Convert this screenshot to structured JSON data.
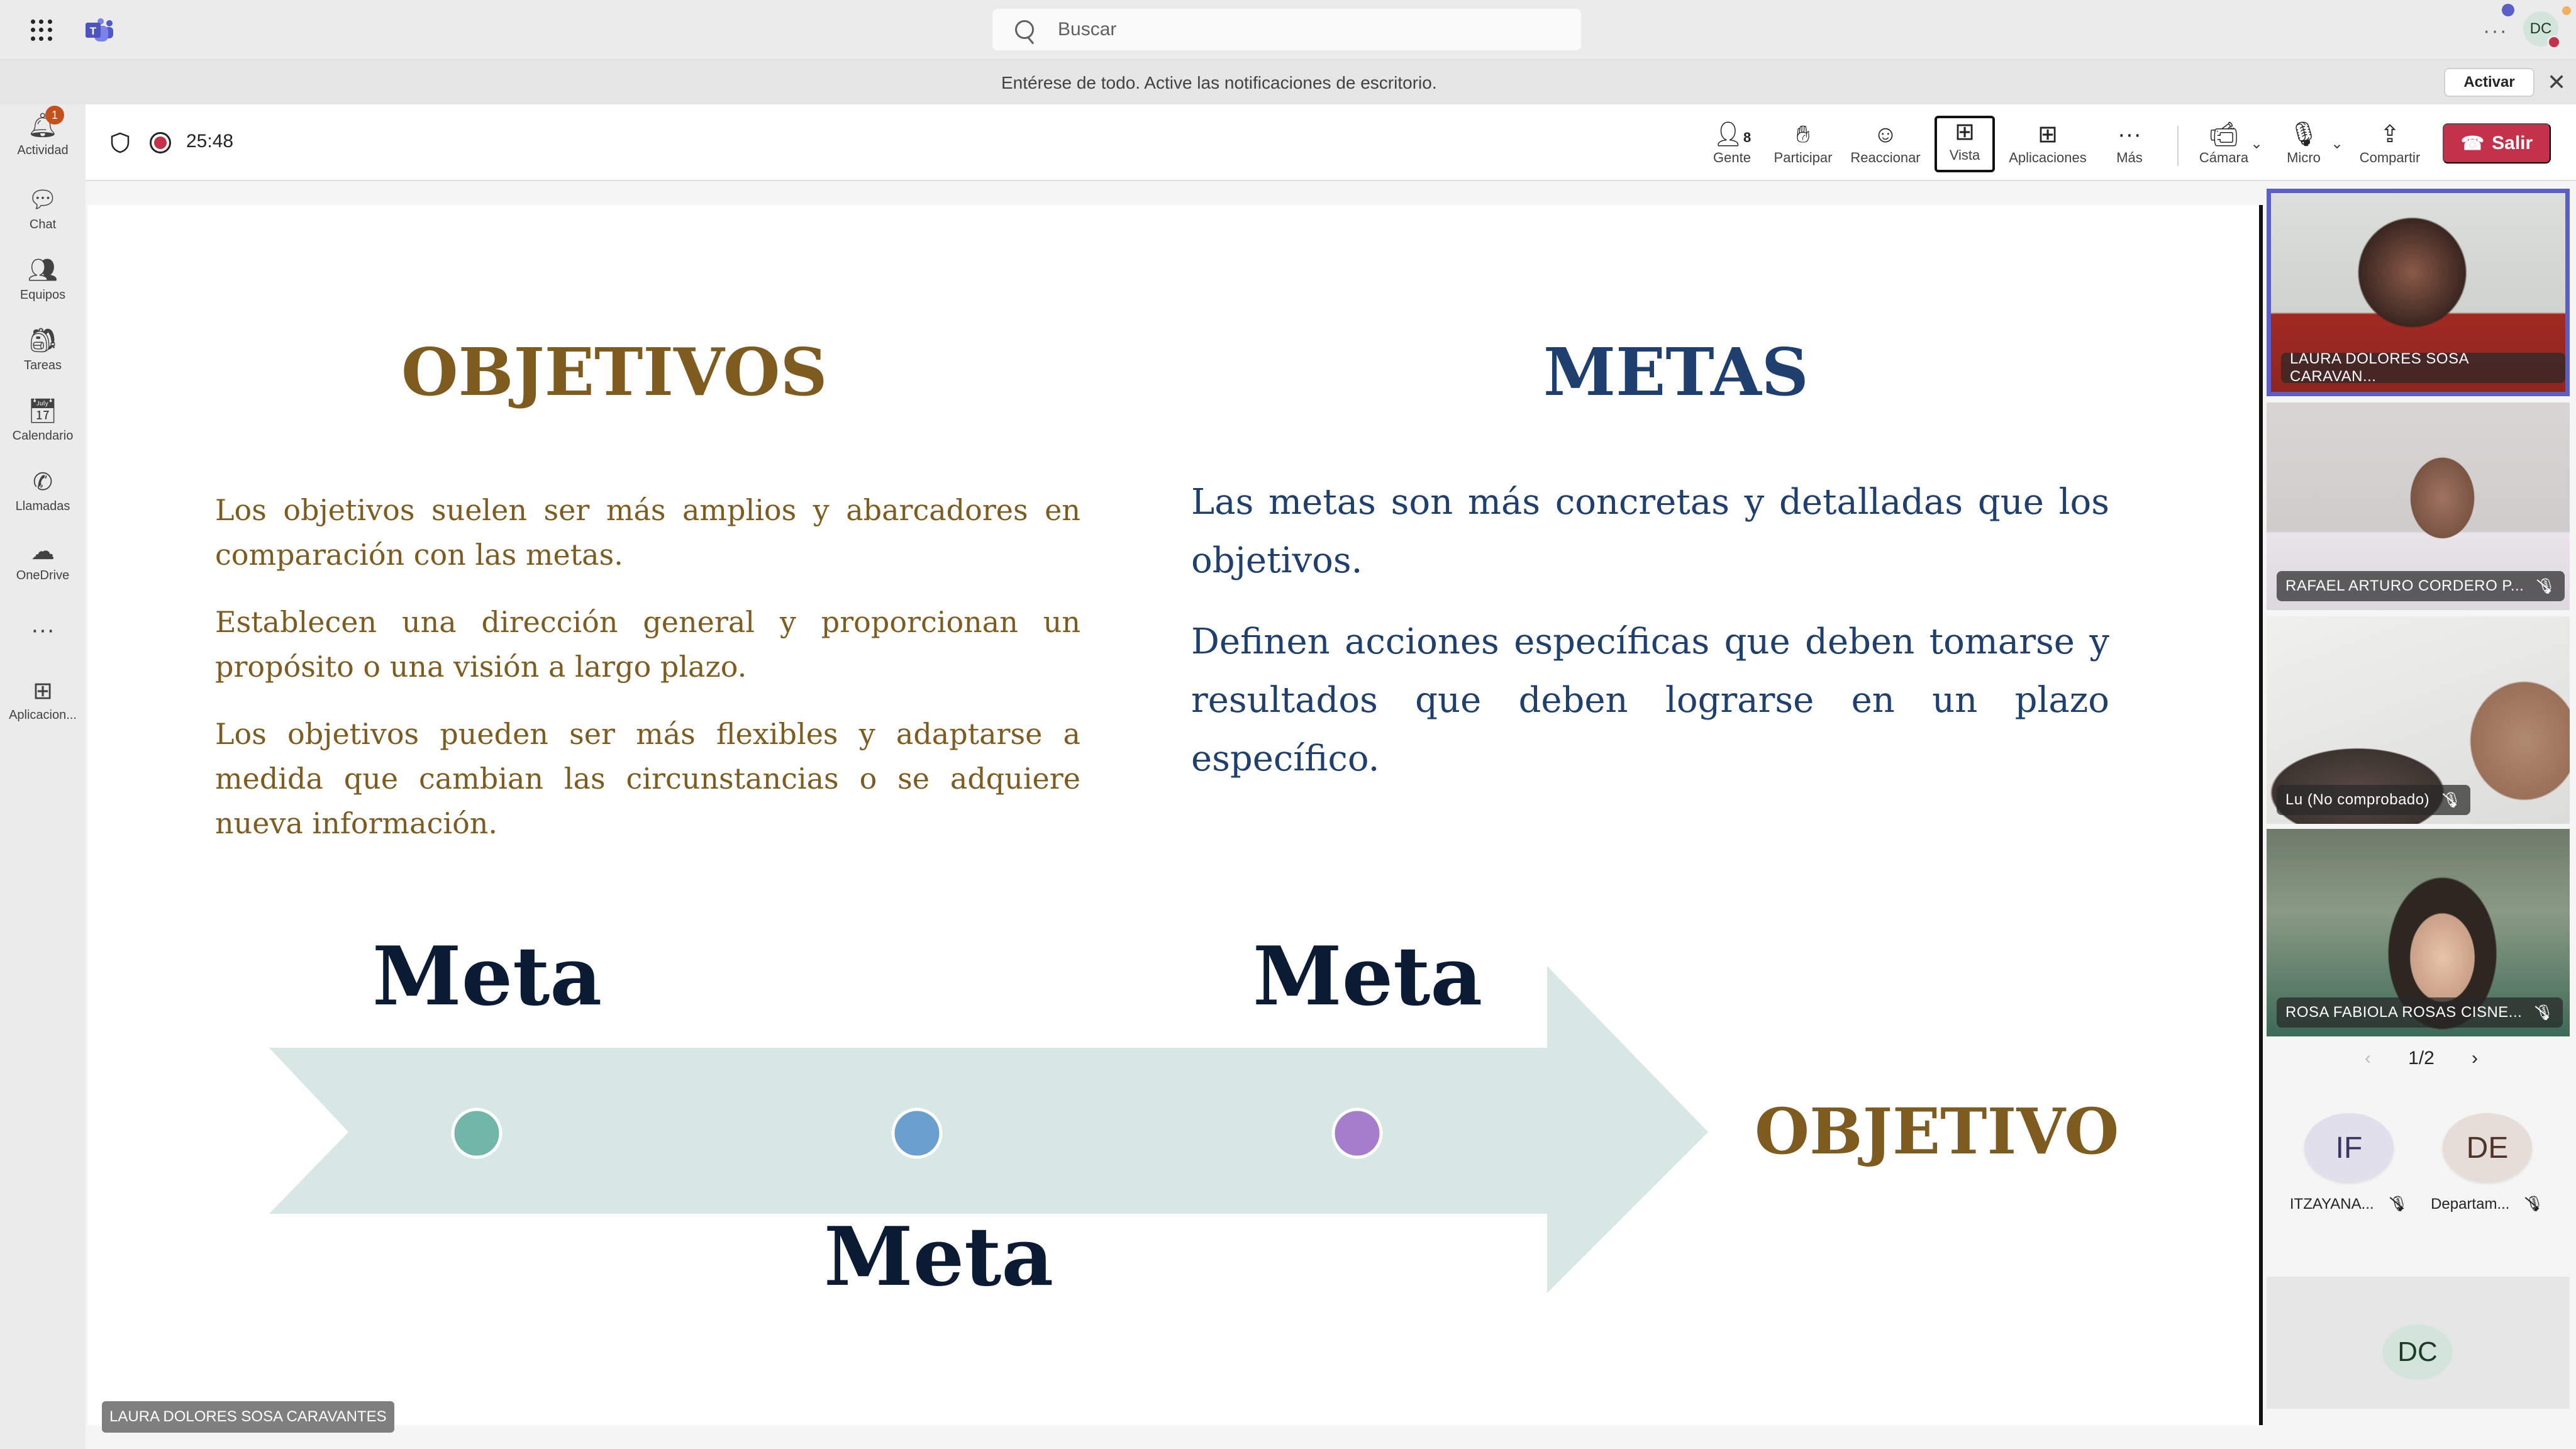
{
  "app": {
    "name": "Microsoft Teams"
  },
  "titlebar": {
    "search_placeholder": "Buscar",
    "more_label": "···",
    "user_initials": "DC"
  },
  "notification": {
    "message": "Entérese de todo. Active las notificaciones de escritorio.",
    "action_label": "Activar",
    "close_label": "✕"
  },
  "rail": {
    "items": [
      {
        "label": "Actividad",
        "icon": "bell-icon",
        "glyph": "🔔︎",
        "badge": "1"
      },
      {
        "label": "Chat",
        "icon": "chat-icon",
        "glyph": "💬︎"
      },
      {
        "label": "Equipos",
        "icon": "teams-icon",
        "glyph": "👥︎"
      },
      {
        "label": "Tareas",
        "icon": "tasks-icon",
        "glyph": "🎒︎"
      },
      {
        "label": "Calendario",
        "icon": "calendar-icon",
        "glyph": "📅︎"
      },
      {
        "label": "Llamadas",
        "icon": "phone-icon",
        "glyph": "✆"
      },
      {
        "label": "OneDrive",
        "icon": "cloud-icon",
        "glyph": "☁"
      },
      {
        "label": "",
        "icon": "more-icon",
        "glyph": "···"
      },
      {
        "label": "Aplicacion...",
        "icon": "add-app-icon",
        "glyph": "⊞"
      }
    ]
  },
  "meeting": {
    "timer": "25:48",
    "toolbar": [
      {
        "label": "Gente",
        "glyph": "👤︎",
        "count": "8",
        "icon": "people-icon"
      },
      {
        "label": "Participar",
        "glyph": "✋︎",
        "icon": "raise-hand-icon"
      },
      {
        "label": "Reaccionar",
        "glyph": "☺",
        "icon": "reaction-icon"
      },
      {
        "label": "Vista",
        "glyph": "⊞",
        "icon": "view-icon"
      },
      {
        "label": "Aplicaciones",
        "glyph": "⊞",
        "icon": "apps-icon"
      },
      {
        "label": "Más",
        "glyph": "···",
        "icon": "more-icon"
      },
      {
        "label": "Cámara",
        "glyph": "📹︎",
        "icon": "camera-off-icon"
      },
      {
        "label": "Micro",
        "glyph": "🎙︎",
        "icon": "mic-off-icon"
      },
      {
        "label": "Compartir",
        "glyph": "⇪",
        "icon": "share-icon"
      }
    ],
    "leave_label": "Salir"
  },
  "slide": {
    "objetivos_title": "OBJETIVOS",
    "metas_title": "METAS",
    "objetivos_paragraphs": [
      "Los objetivos suelen ser más amplios y abarcadores en comparación con las metas.",
      "Establecen una dirección general y proporcionan un propósito o una visión a largo plazo.",
      "Los objetivos pueden ser más flexibles y adaptarse a medida que cambian las circunstancias o se adquiere nueva información."
    ],
    "metas_paragraphs": [
      "Las metas son más concretas y detalladas que los objetivos.",
      "Definen acciones específicas que deben tomarse y resultados que deben lograrse en un plazo específico."
    ],
    "diagram": {
      "meta_labels": [
        "Meta",
        "Meta",
        "Meta"
      ],
      "end_label": "OBJETIVO",
      "dot_colors": [
        "#72b6a9",
        "#6a9fd0",
        "#a47dcc"
      ],
      "arrow_color": "#d7e7e3"
    },
    "presenter_name": "LAURA DOLORES SOSA CARAVANTES"
  },
  "participants": {
    "video_tiles": [
      {
        "name": "LAURA DOLORES SOSA CARAVAN...",
        "muted": false,
        "active_speaker": true
      },
      {
        "name": "RAFAEL ARTURO CORDERO P...",
        "muted": true
      },
      {
        "name": "Lu (No comprobado)",
        "muted": true
      },
      {
        "name": "ROSA FABIOLA ROSAS CISNE...",
        "muted": true
      }
    ],
    "pager": {
      "label": "1/2",
      "prev": "‹",
      "next": "›"
    },
    "avatars": [
      {
        "initials": "IF",
        "name": "ITZAYANA...",
        "muted": true,
        "bg": "#e2dfec",
        "fg": "#3c3461"
      },
      {
        "initials": "DE",
        "name": "Departam...",
        "muted": true,
        "bg": "#e6ddd8",
        "fg": "#4f3527"
      }
    ],
    "self": {
      "initials": "DC"
    }
  },
  "colors": {
    "brand": "#5b5fc7",
    "leave": "#c4314b",
    "objetivos": "#7e5b1f",
    "metas": "#1f406f"
  }
}
